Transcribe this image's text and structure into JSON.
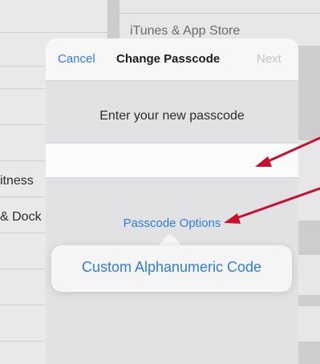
{
  "background": {
    "left_items": [
      "itness",
      "& Dock"
    ],
    "right_items": [
      "iTunes & App Store"
    ]
  },
  "sheet": {
    "cancel_label": "Cancel",
    "title": "Change Passcode",
    "next_label": "Next",
    "prompt": "Enter your new passcode",
    "passcode_value": "",
    "options_link": "Passcode Options"
  },
  "popup": {
    "option": "Custom Alphanumeric Code"
  },
  "colors": {
    "accent": "#2f7de1",
    "annotation": "#c8102e"
  }
}
